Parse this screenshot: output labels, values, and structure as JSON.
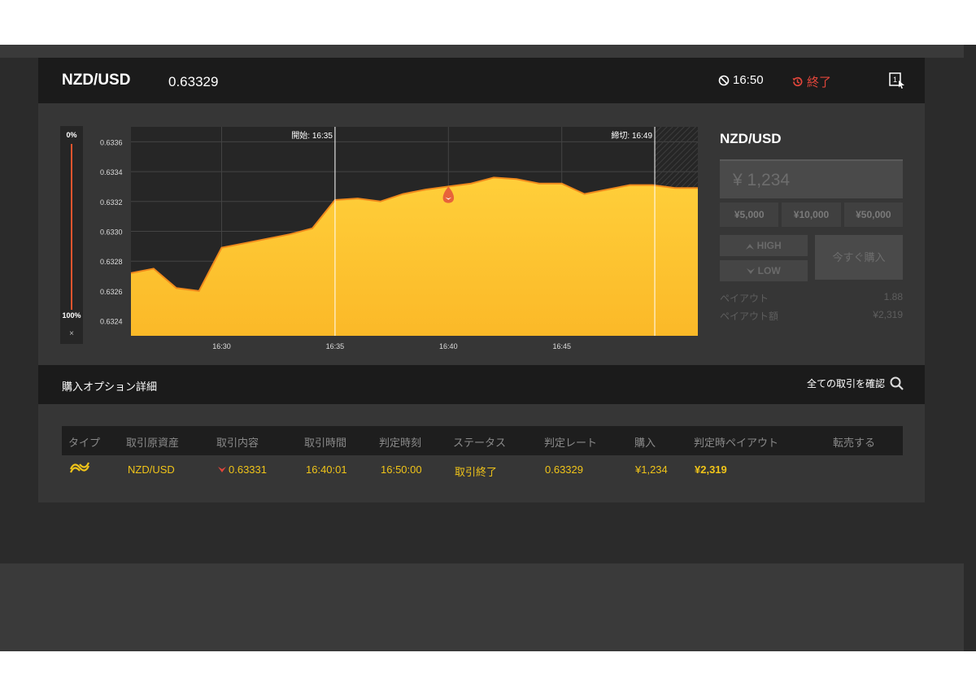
{
  "header": {
    "pair": "NZD/USD",
    "rate": "0.63329",
    "timer": "16:50",
    "status": "終了"
  },
  "gauge": {
    "top_label": "0%",
    "bottom_label": "100%",
    "close": "×"
  },
  "chart_data": {
    "type": "area",
    "start_label": "開始: 16:35",
    "end_label": "締切: 16:49",
    "x_ticks": [
      "16:30",
      "16:35",
      "16:40",
      "16:45"
    ],
    "y_ticks": [
      "0.6336",
      "0.6334",
      "0.6332",
      "0.6330",
      "0.6328",
      "0.6326",
      "0.6324"
    ],
    "ylim": [
      0.6323,
      0.6337
    ],
    "xlim": [
      "16:26",
      "16:51"
    ],
    "x": [
      "16:26",
      "16:27",
      "16:28",
      "16:29",
      "16:30",
      "16:31",
      "16:32",
      "16:33",
      "16:34",
      "16:35",
      "16:36",
      "16:37",
      "16:38",
      "16:39",
      "16:40",
      "16:41",
      "16:42",
      "16:43",
      "16:44",
      "16:45",
      "16:46",
      "16:47",
      "16:48",
      "16:49",
      "16:50",
      "16:51"
    ],
    "values": [
      0.63272,
      0.63275,
      0.63262,
      0.6326,
      0.63289,
      0.63292,
      0.63295,
      0.63298,
      0.63302,
      0.63321,
      0.63322,
      0.6332,
      0.63325,
      0.63328,
      0.6333,
      0.63332,
      0.63336,
      0.63335,
      0.63332,
      0.63332,
      0.63325,
      0.63328,
      0.63331,
      0.63331,
      0.63329,
      0.63329
    ],
    "entry_marker": {
      "time": "16:40",
      "value": 0.63331
    },
    "colors": {
      "fill": "#fcbc2e",
      "line": "#f08a1c",
      "grid": "#444444",
      "bg": "#262626"
    }
  },
  "trade": {
    "title": "NZD/USD",
    "amount": "¥ 1,234",
    "quick": [
      "¥5,000",
      "¥10,000",
      "¥50,000"
    ],
    "high": "HIGH",
    "low": "LOW",
    "buy": "今すぐ購入",
    "payout_label": "ペイアウト",
    "payout_value": "1.88",
    "payout_amount_label": "ペイアウト額",
    "payout_amount_value": "¥2,319"
  },
  "details": {
    "title": "購入オプション詳細",
    "check_all": "全ての取引を確認"
  },
  "table": {
    "headers": [
      "タイプ",
      "取引原資産",
      "取引内容",
      "取引時間",
      "判定時刻",
      "ステータス",
      "判定レート",
      "購入",
      "判定時ペイアウト",
      "転売する"
    ],
    "row": {
      "asset": "NZD/USD",
      "content": "0.63331",
      "time": "16:40:01",
      "judge_time": "16:50:00",
      "status": "取引終了",
      "judge_rate": "0.63329",
      "purchase": "¥1,234",
      "payout": "¥2,319"
    }
  }
}
